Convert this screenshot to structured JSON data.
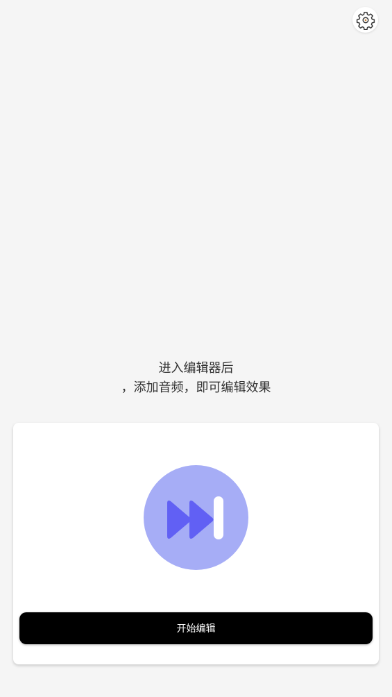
{
  "header": {
    "settings_icon": "gear-icon"
  },
  "hint": {
    "line1": "进入编辑器后",
    "line2": "，添加音频，即可编辑效果"
  },
  "card": {
    "icon": "skip-forward-icon",
    "start_button_label": "开始编辑"
  },
  "colors": {
    "background": "#f5f5f5",
    "card": "#ffffff",
    "icon_circle": "#a6adf6",
    "icon_arrows": "#6160f4",
    "button": "#000000",
    "button_text": "#ffffff"
  }
}
